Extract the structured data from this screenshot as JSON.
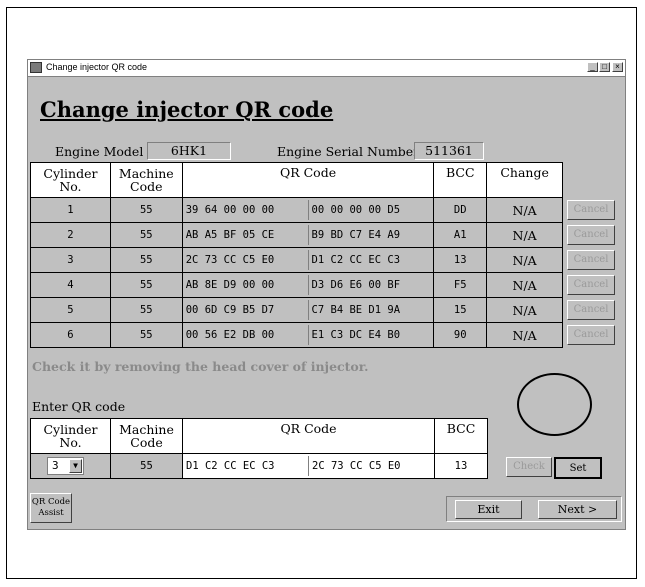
{
  "window": {
    "title": "Change injector QR code",
    "min_label": "_",
    "max_label": "□",
    "close_label": "×"
  },
  "heading": "Change injector QR code",
  "engine": {
    "model_label": "Engine Model",
    "model_value": "6HK1",
    "serial_label": "Engine Serial Number",
    "serial_value": "511361"
  },
  "table": {
    "headers": {
      "cylinder": [
        "Cylinder",
        "No."
      ],
      "machine": [
        "Machine",
        "Code"
      ],
      "qr": "QR Code",
      "bcc": "BCC",
      "change": "Change"
    },
    "rows": [
      {
        "cyl": "1",
        "mc": "55",
        "qr1": "39 64 00 00 00",
        "qr2": "00 00 00 00 D5",
        "bcc": "DD",
        "change": "N/A",
        "cancel": "Cancel"
      },
      {
        "cyl": "2",
        "mc": "55",
        "qr1": "AB A5 BF 05 CE",
        "qr2": "B9 BD C7 E4 A9",
        "bcc": "A1",
        "change": "N/A",
        "cancel": "Cancel"
      },
      {
        "cyl": "3",
        "mc": "55",
        "qr1": "2C 73 CC C5 E0",
        "qr2": "D1 C2 CC EC C3",
        "bcc": "13",
        "change": "N/A",
        "cancel": "Cancel"
      },
      {
        "cyl": "4",
        "mc": "55",
        "qr1": "AB 8E D9 00 00",
        "qr2": "D3 D6 E6 00 BF",
        "bcc": "F5",
        "change": "N/A",
        "cancel": "Cancel"
      },
      {
        "cyl": "5",
        "mc": "55",
        "qr1": "00 6D C9 B5 D7",
        "qr2": "C7 B4 BE D1 9A",
        "bcc": "15",
        "change": "N/A",
        "cancel": "Cancel"
      },
      {
        "cyl": "6",
        "mc": "55",
        "qr1": "00 56 E2 DB 00",
        "qr2": "E1 C3 DC E4 B0",
        "bcc": "90",
        "change": "N/A",
        "cancel": "Cancel"
      }
    ]
  },
  "note": "Check it by removing the head cover of injector.",
  "entry": {
    "label": "Enter QR code",
    "headers": {
      "cylinder": [
        "Cylinder",
        "No."
      ],
      "machine": [
        "Machine",
        "Code"
      ],
      "qr": "QR Code",
      "bcc": "BCC"
    },
    "cylinder_selected": "3",
    "machine_code": "55",
    "qr1": "D1 C2 CC EC C3",
    "qr2": "2C 73 CC C5 E0",
    "bcc": "13",
    "check_label": "Check",
    "set_label": "Set"
  },
  "buttons": {
    "qr_assist": [
      "QR Code",
      "Assist"
    ],
    "exit": "Exit",
    "next": "Next >"
  }
}
